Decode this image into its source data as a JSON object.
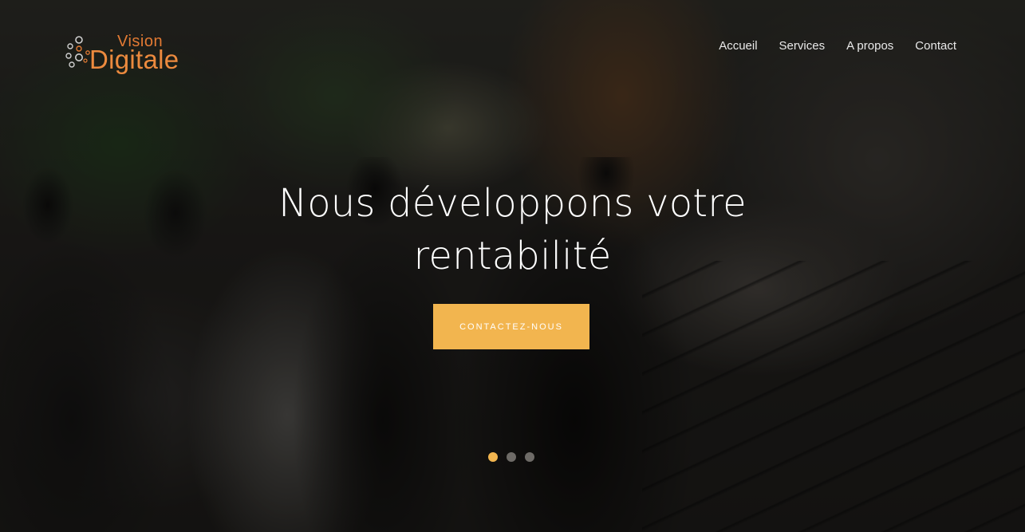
{
  "logo": {
    "line1": "Vision",
    "line2": "Digitale",
    "icon": "dots-cluster-logo-icon",
    "color": "#ec8a3e"
  },
  "nav": {
    "items": [
      {
        "label": "Accueil"
      },
      {
        "label": "Services"
      },
      {
        "label": "A propos"
      },
      {
        "label": "Contact"
      }
    ]
  },
  "hero": {
    "title_line1": "Nous développons votre",
    "title_line2": "rentabilité",
    "cta_label": "CONTACTEZ-NOUS",
    "accent_color": "#f2b54f"
  },
  "slider": {
    "dot_count": 3,
    "active_index": 0
  }
}
